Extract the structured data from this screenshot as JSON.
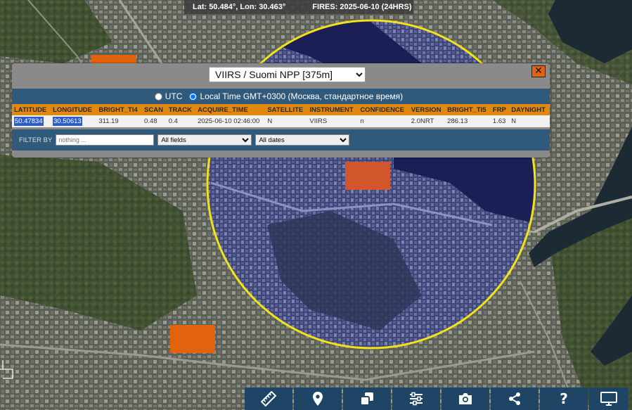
{
  "status": {
    "coords": "Lat: 50.484°, Lon: 30.463°",
    "fires": "FIRES: 2025-06-10 (24HRS)"
  },
  "panel": {
    "sensor_options": [
      "VIIRS / Suomi NPP [375m]"
    ],
    "sensor_selected": "VIIRS / Suomi NPP [375m]",
    "close_label": "✕",
    "time_options": [
      {
        "label": "UTC",
        "checked": false
      },
      {
        "label": "Local Time GMT+0300 (Москва, стандартное время)",
        "checked": true
      }
    ],
    "table": {
      "columns": [
        "LATITUDE",
        "LONGITUDE",
        "BRIGHT_TI4",
        "SCAN",
        "TRACK",
        "ACQUIRE_TIME",
        "SATELLITE",
        "INSTRUMENT",
        "CONFIDENCE",
        "VERSION",
        "BRIGHT_TI5",
        "FRP",
        "DAYNIGHT"
      ],
      "rows": [
        [
          "50.47834",
          "30.50613",
          "311.19",
          "0.48",
          "0.4",
          "2025-06-10 02:46:00",
          "N",
          "VIIRS",
          "n",
          "2.0NRT",
          "286.13",
          "1.63",
          "N"
        ]
      ]
    },
    "filter": {
      "label": "FILTER BY",
      "placeholder": "nothing ...",
      "field_selected": "All fields",
      "date_selected": "All dates"
    }
  },
  "toolbar": [
    {
      "name": "measure-ruler-icon"
    },
    {
      "name": "location-pin-icon"
    },
    {
      "name": "layers-copy-icon"
    },
    {
      "name": "settings-sliders-icon"
    },
    {
      "name": "camera-icon"
    },
    {
      "name": "share-icon"
    },
    {
      "name": "help-icon",
      "label": "?"
    },
    {
      "name": "monitor-icon"
    }
  ],
  "colors": {
    "fire_marker": "#e2620d",
    "highlight_circle": "#f2e21a",
    "panel_blue": "#2f5a7c",
    "table_header": "#e08810",
    "toolbar": "#1e4566"
  }
}
